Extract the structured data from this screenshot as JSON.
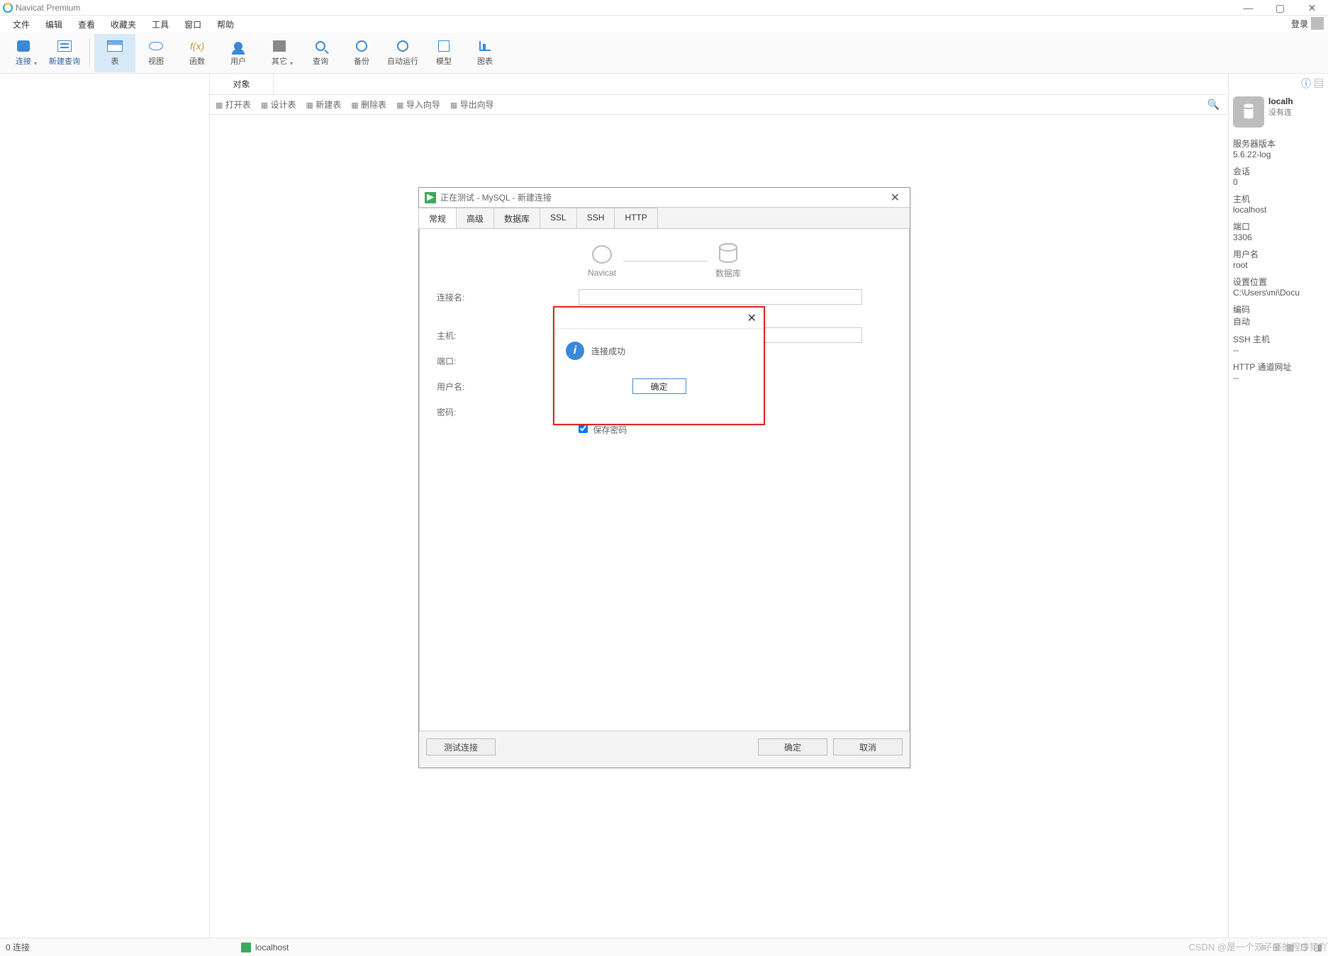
{
  "titlebar": {
    "title": "Navicat Premium"
  },
  "window_controls": {
    "min": "—",
    "max": "▢",
    "close": "✕"
  },
  "menubar": [
    "文件",
    "编辑",
    "查看",
    "收藏夹",
    "工具",
    "窗口",
    "帮助"
  ],
  "login_label": "登录",
  "toolbar": [
    {
      "label": "连接"
    },
    {
      "label": "新建查询"
    },
    {
      "label": "表"
    },
    {
      "label": "视图"
    },
    {
      "label": "函数"
    },
    {
      "label": "用户"
    },
    {
      "label": "其它"
    },
    {
      "label": "查询"
    },
    {
      "label": "备份"
    },
    {
      "label": "自动运行"
    },
    {
      "label": "模型"
    },
    {
      "label": "图表"
    }
  ],
  "objects_tab": "对象",
  "object_actions": [
    "打开表",
    "设计表",
    "新建表",
    "删除表",
    "导入向导",
    "导出向导"
  ],
  "right": {
    "conn_name": "localh",
    "conn_state": "没有连",
    "server_version_label": "服务器版本",
    "server_version": "5.6.22-log",
    "session_label": "会话",
    "session": "0",
    "host_label": "主机",
    "host": "localhost",
    "port_label": "端口",
    "port": "3306",
    "user_label": "用户名",
    "user": "root",
    "settings_loc_label": "设置位置",
    "settings_loc": "C:\\Users\\mi\\Docu",
    "encoding_label": "编码",
    "encoding": "自动",
    "ssh_host_label": "SSH 主机",
    "ssh_host": "--",
    "http_label": "HTTP 通道网址",
    "http": "--"
  },
  "dialog": {
    "title": "正在测试 - MySQL - 新建连接",
    "tabs": [
      "常规",
      "高级",
      "数据库",
      "SSL",
      "SSH",
      "HTTP"
    ],
    "logo_navicat": "Navicat",
    "logo_db": "数据库",
    "fields": {
      "conn_name_label": "连接名:",
      "conn_name": "",
      "host_label": "主机:",
      "host": "",
      "port_label": "端口:",
      "port": "",
      "user_label": "用户名:",
      "user": "",
      "password_label": "密码:",
      "password": "●●●●●●●●●●●●●",
      "save_pw_label": "保存密码"
    },
    "buttons": {
      "test": "测试连接",
      "ok": "确定",
      "cancel": "取消"
    }
  },
  "alert": {
    "message": "连接成功",
    "ok": "确定"
  },
  "statusbar": {
    "conn_count": "0 连接",
    "current": "localhost"
  },
  "watermark": "CSDN @是一个双子座的程序猿吖"
}
